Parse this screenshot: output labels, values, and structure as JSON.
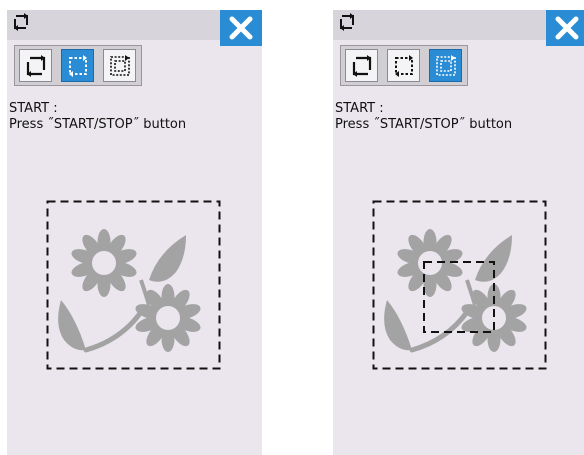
{
  "screens": [
    {
      "title_icon": "frame-trace-icon",
      "close_icon": "close-x-icon",
      "modes": [
        {
          "icon": "trace-outer-frame-icon",
          "active": false
        },
        {
          "icon": "trace-design-frame-icon",
          "active": true
        },
        {
          "icon": "trace-inner-frame-icon",
          "active": false
        }
      ],
      "message_line1": "START :",
      "message_line2": "Press ˝START/STOP˝ button",
      "preview_icon": "flower-embroidery-design",
      "inner_frame_shown": false
    },
    {
      "title_icon": "frame-trace-icon",
      "close_icon": "close-x-icon",
      "modes": [
        {
          "icon": "trace-outer-frame-icon",
          "active": false
        },
        {
          "icon": "trace-design-frame-icon",
          "active": false
        },
        {
          "icon": "trace-inner-frame-icon",
          "active": true
        }
      ],
      "message_line1": "START :",
      "message_line2": "Press ˝START/STOP˝ button",
      "preview_icon": "flower-embroidery-design",
      "inner_frame_shown": true
    }
  ],
  "colors": {
    "accent": "#2a8cd4",
    "panel_bg": "#ebe6ee",
    "titlebar_bg": "#d8d4dc",
    "design_gray": "#a3a3a3"
  }
}
